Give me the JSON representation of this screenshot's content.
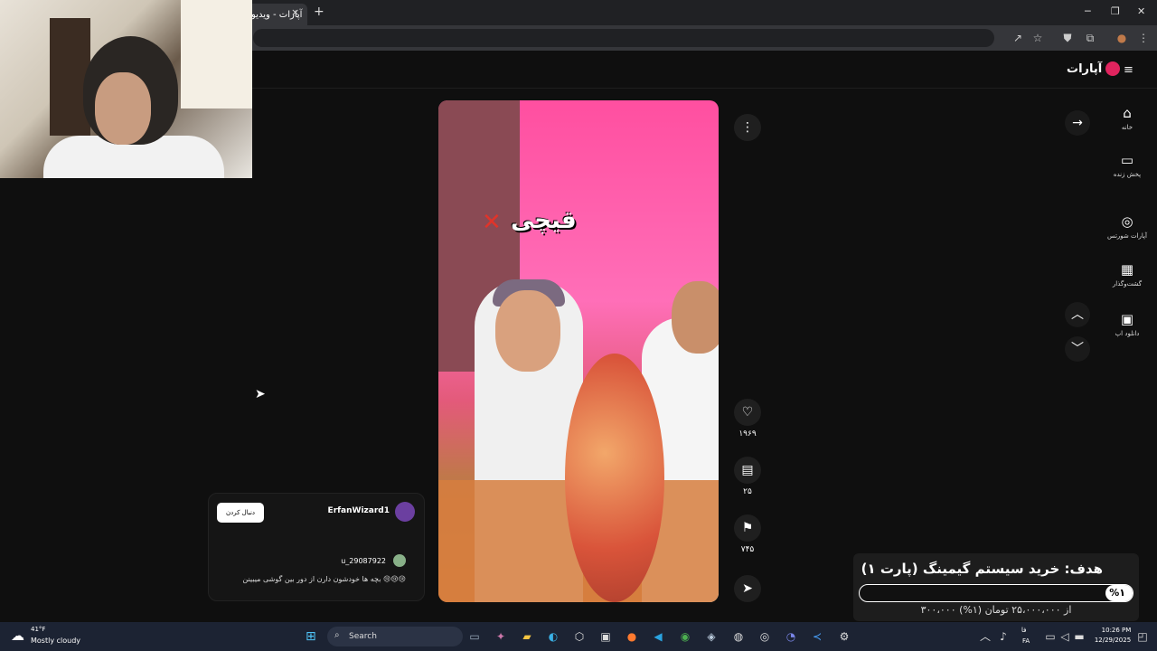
{
  "browser": {
    "tab_title": "آپارات - ویدیو",
    "close_tab_icon": "×",
    "new_tab_icon": "+",
    "window_controls": [
      "─",
      "❐",
      "✕"
    ],
    "toolbar_icons": [
      "↗",
      "☆",
      "⛊",
      "⧉",
      "●",
      "⋮"
    ]
  },
  "site": {
    "logo_text": "آپارات",
    "menu_icon": "≡",
    "sidebar": [
      {
        "label": "خانه",
        "icon": "⌂"
      },
      {
        "label": "پخش زنده",
        "icon": "▭"
      },
      {
        "label": "آپارات شورتس",
        "icon": "◎"
      },
      {
        "label": "گشت‌وگذار",
        "icon": "▦"
      },
      {
        "label": "دانلود اپ",
        "icon": "▣"
      }
    ]
  },
  "video": {
    "overlay_text": "قیچی",
    "overlay_mark": "✕",
    "more_icon": "⋮",
    "likes": "۱۹۶۹",
    "comments_count": "۲۵",
    "saves": "۷۴۵",
    "like_icon": "♡",
    "comment_icon": "▤",
    "bookmark_icon": "⚑",
    "share_icon": "➤"
  },
  "nav": {
    "forward_icon": "→",
    "up_icon": "︿",
    "down_icon": "﹀"
  },
  "comments": {
    "follow_label": "دنبال کردن",
    "channel_name": "ErfanWizard1",
    "comment_user": "u_29087922",
    "comment_text": "بچه ها خودشون دارن از دور بین گوشی میبینن 😢😢😢"
  },
  "goal": {
    "title": "هدف: خرید سیستم گیمینگ (پارت ۱)",
    "percent_label": "%۱",
    "progress": 0.01,
    "amount": "۳۰۰،۰۰۰ از ۲۵،۰۰۰،۰۰۰ تومان (۱%)"
  },
  "taskbar": {
    "weather_temp": "41°F",
    "weather_desc": "Mostly cloudy",
    "weather_icon": "☁",
    "start_icon": "⊞",
    "search_placeholder": "Search",
    "search_icon": "⌕",
    "lang_top": "فا",
    "lang_bottom": "FA",
    "time": "10:26 PM",
    "date": "12/29/2025"
  }
}
